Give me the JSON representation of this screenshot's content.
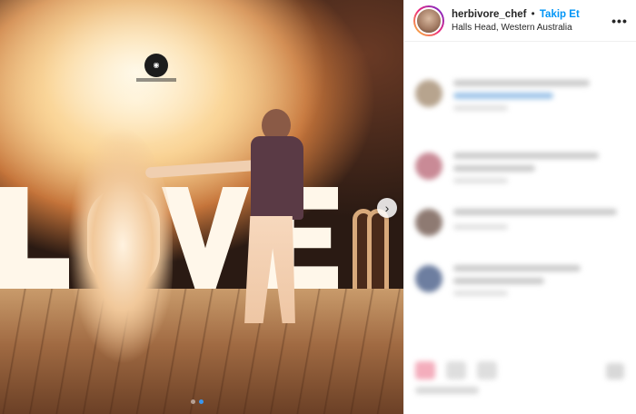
{
  "post": {
    "username": "herbivore_chef",
    "separator": "•",
    "follow_label": "Takip Et",
    "location": "Halls Head, Western Australia"
  },
  "photo": {
    "carousel_dots": 2,
    "active_dot": 1
  },
  "icons": {
    "more": "more-horizontal-icon",
    "next": "chevron-right-icon"
  },
  "colors": {
    "follow": "#0095f6",
    "username": "#262626",
    "story_ring": [
      "#f9ce34",
      "#ee2a7b",
      "#6228d7"
    ]
  }
}
